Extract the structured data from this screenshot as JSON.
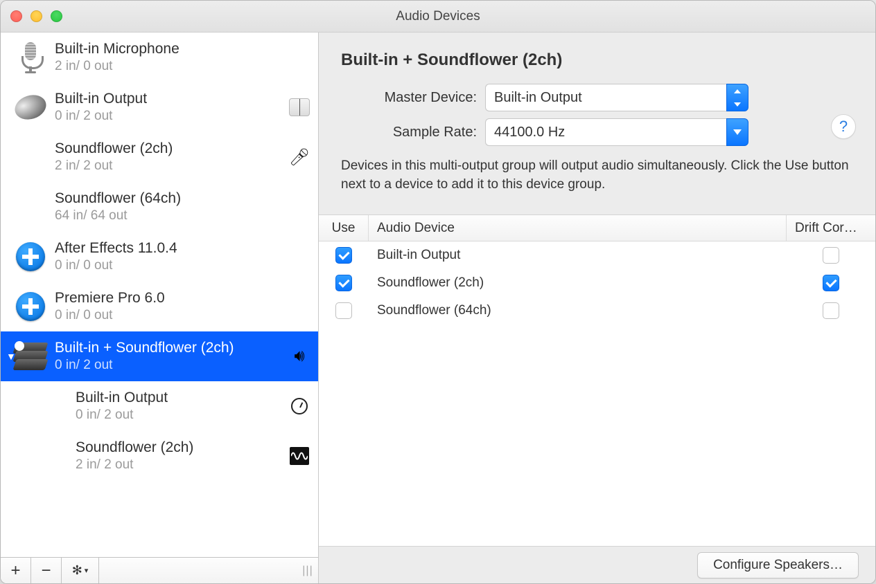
{
  "window": {
    "title": "Audio Devices"
  },
  "sidebar": {
    "devices": [
      {
        "name": "Built-in Microphone",
        "sub": "2 in/ 0 out",
        "icon": "mic"
      },
      {
        "name": "Built-in Output",
        "sub": "0 in/ 2 out",
        "icon": "speaker",
        "badge": "finder"
      },
      {
        "name": "Soundflower (2ch)",
        "sub": "2 in/ 2 out",
        "icon": "none",
        "badge": "mic"
      },
      {
        "name": "Soundflower (64ch)",
        "sub": "64 in/ 64 out",
        "icon": "none"
      },
      {
        "name": "After Effects 11.0.4",
        "sub": "0 in/ 0 out",
        "icon": "plus"
      },
      {
        "name": "Premiere Pro 6.0",
        "sub": "0 in/ 0 out",
        "icon": "plus"
      },
      {
        "name": "Built-in + Soundflower (2ch)",
        "sub": "0 in/ 2 out",
        "icon": "stack",
        "selected": true,
        "badge": "volume",
        "expanded": true
      },
      {
        "name": "Built-in Output",
        "sub": "0 in/ 2 out",
        "icon": "none",
        "badge": "clock",
        "child": true
      },
      {
        "name": "Soundflower (2ch)",
        "sub": "2 in/ 2 out",
        "icon": "none",
        "badge": "wave",
        "child": true
      }
    ]
  },
  "detail": {
    "title": "Built-in + Soundflower (2ch)",
    "master_label": "Master Device:",
    "master_value": "Built-in Output",
    "rate_label": "Sample Rate:",
    "rate_value": "44100.0 Hz",
    "hint": "Devices in this multi-output group will output audio simultaneously. Click the Use button next to a device to add it to this device group.",
    "table": {
      "cols": {
        "use": "Use",
        "name": "Audio Device",
        "drift": "Drift Cor…"
      },
      "rows": [
        {
          "use": true,
          "name": "Built-in Output",
          "drift": false
        },
        {
          "use": true,
          "name": "Soundflower (2ch)",
          "drift": true
        },
        {
          "use": false,
          "name": "Soundflower (64ch)",
          "drift": false
        }
      ]
    },
    "configure_label": "Configure Speakers…"
  }
}
